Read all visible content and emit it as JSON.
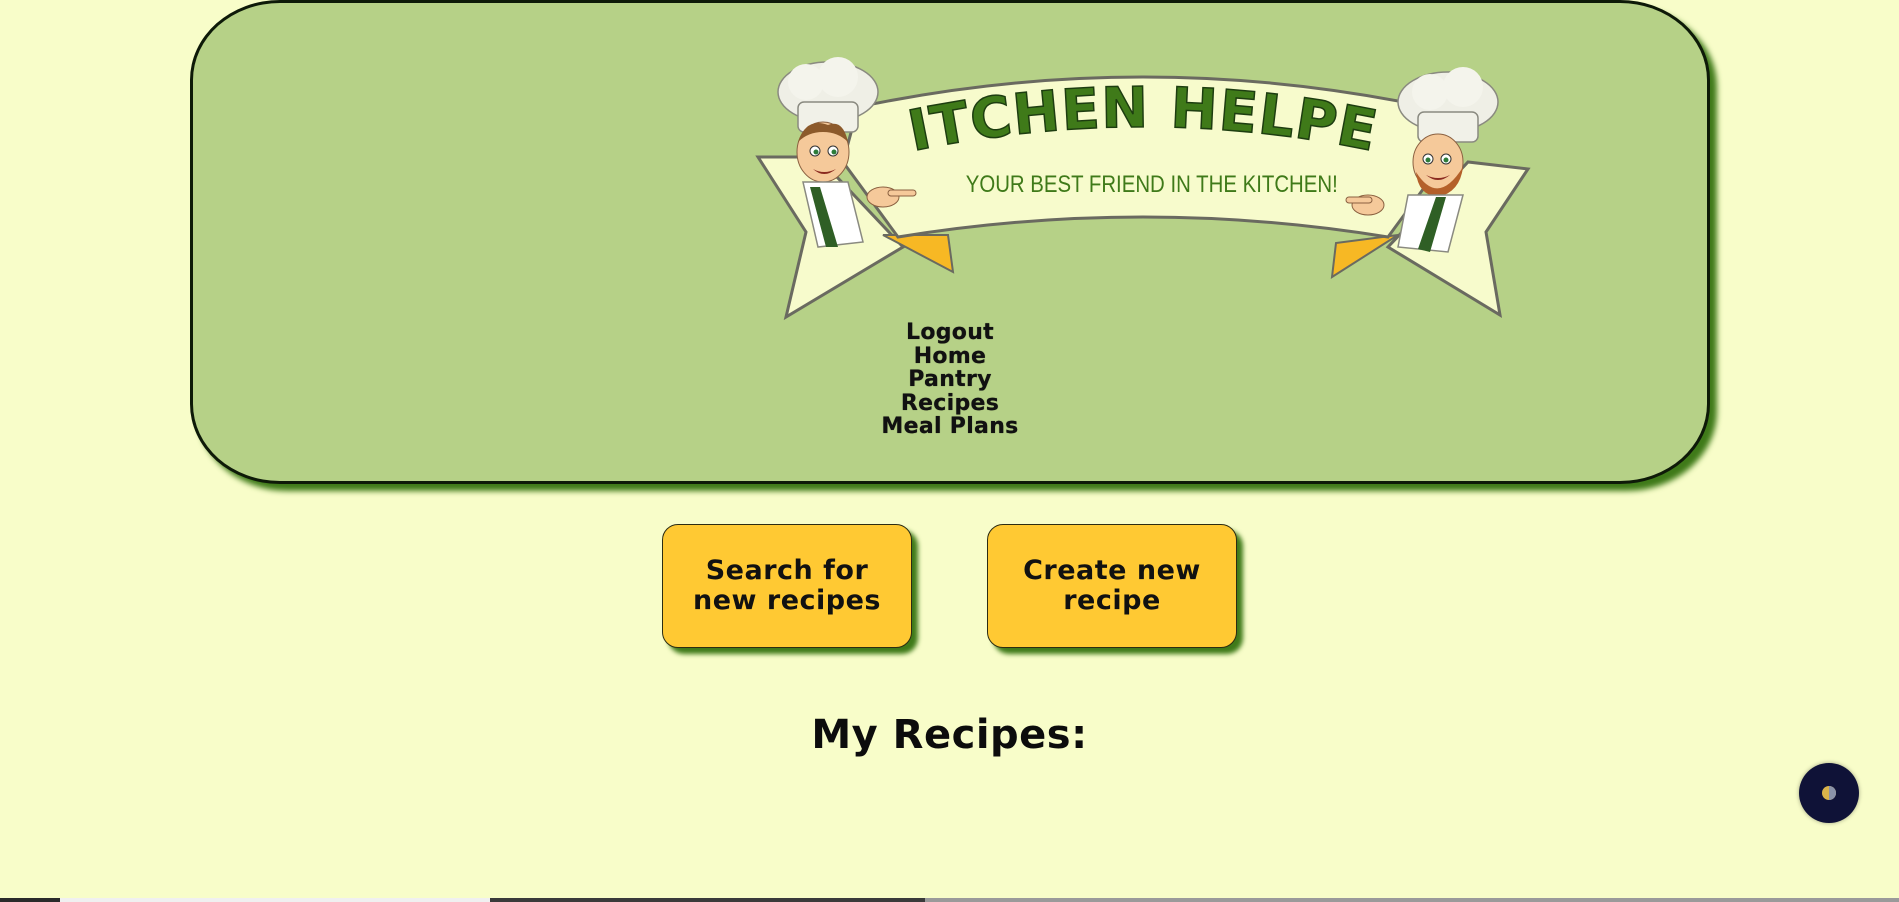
{
  "logo": {
    "title": "KITCHEN HELPER",
    "tagline": "YOUR BEST FRIEND IN THE KITCHEN!"
  },
  "nav": {
    "items": [
      {
        "label": "Logout"
      },
      {
        "label": "Home"
      },
      {
        "label": "Pantry"
      },
      {
        "label": "Recipes"
      },
      {
        "label": "Meal Plans"
      }
    ]
  },
  "actions": {
    "search_label": "Search for new recipes",
    "create_label": "Create new recipe"
  },
  "recipes": {
    "heading": "My Recipes:"
  },
  "theme_toggle": {
    "icon": "half-moon-icon"
  },
  "colors": {
    "page_background": "#f8fdc9",
    "header_background": "#b6d187",
    "button_background": "#ffc933",
    "shadow_green": "#3f7a19",
    "toggle_background": "#0f1237"
  }
}
